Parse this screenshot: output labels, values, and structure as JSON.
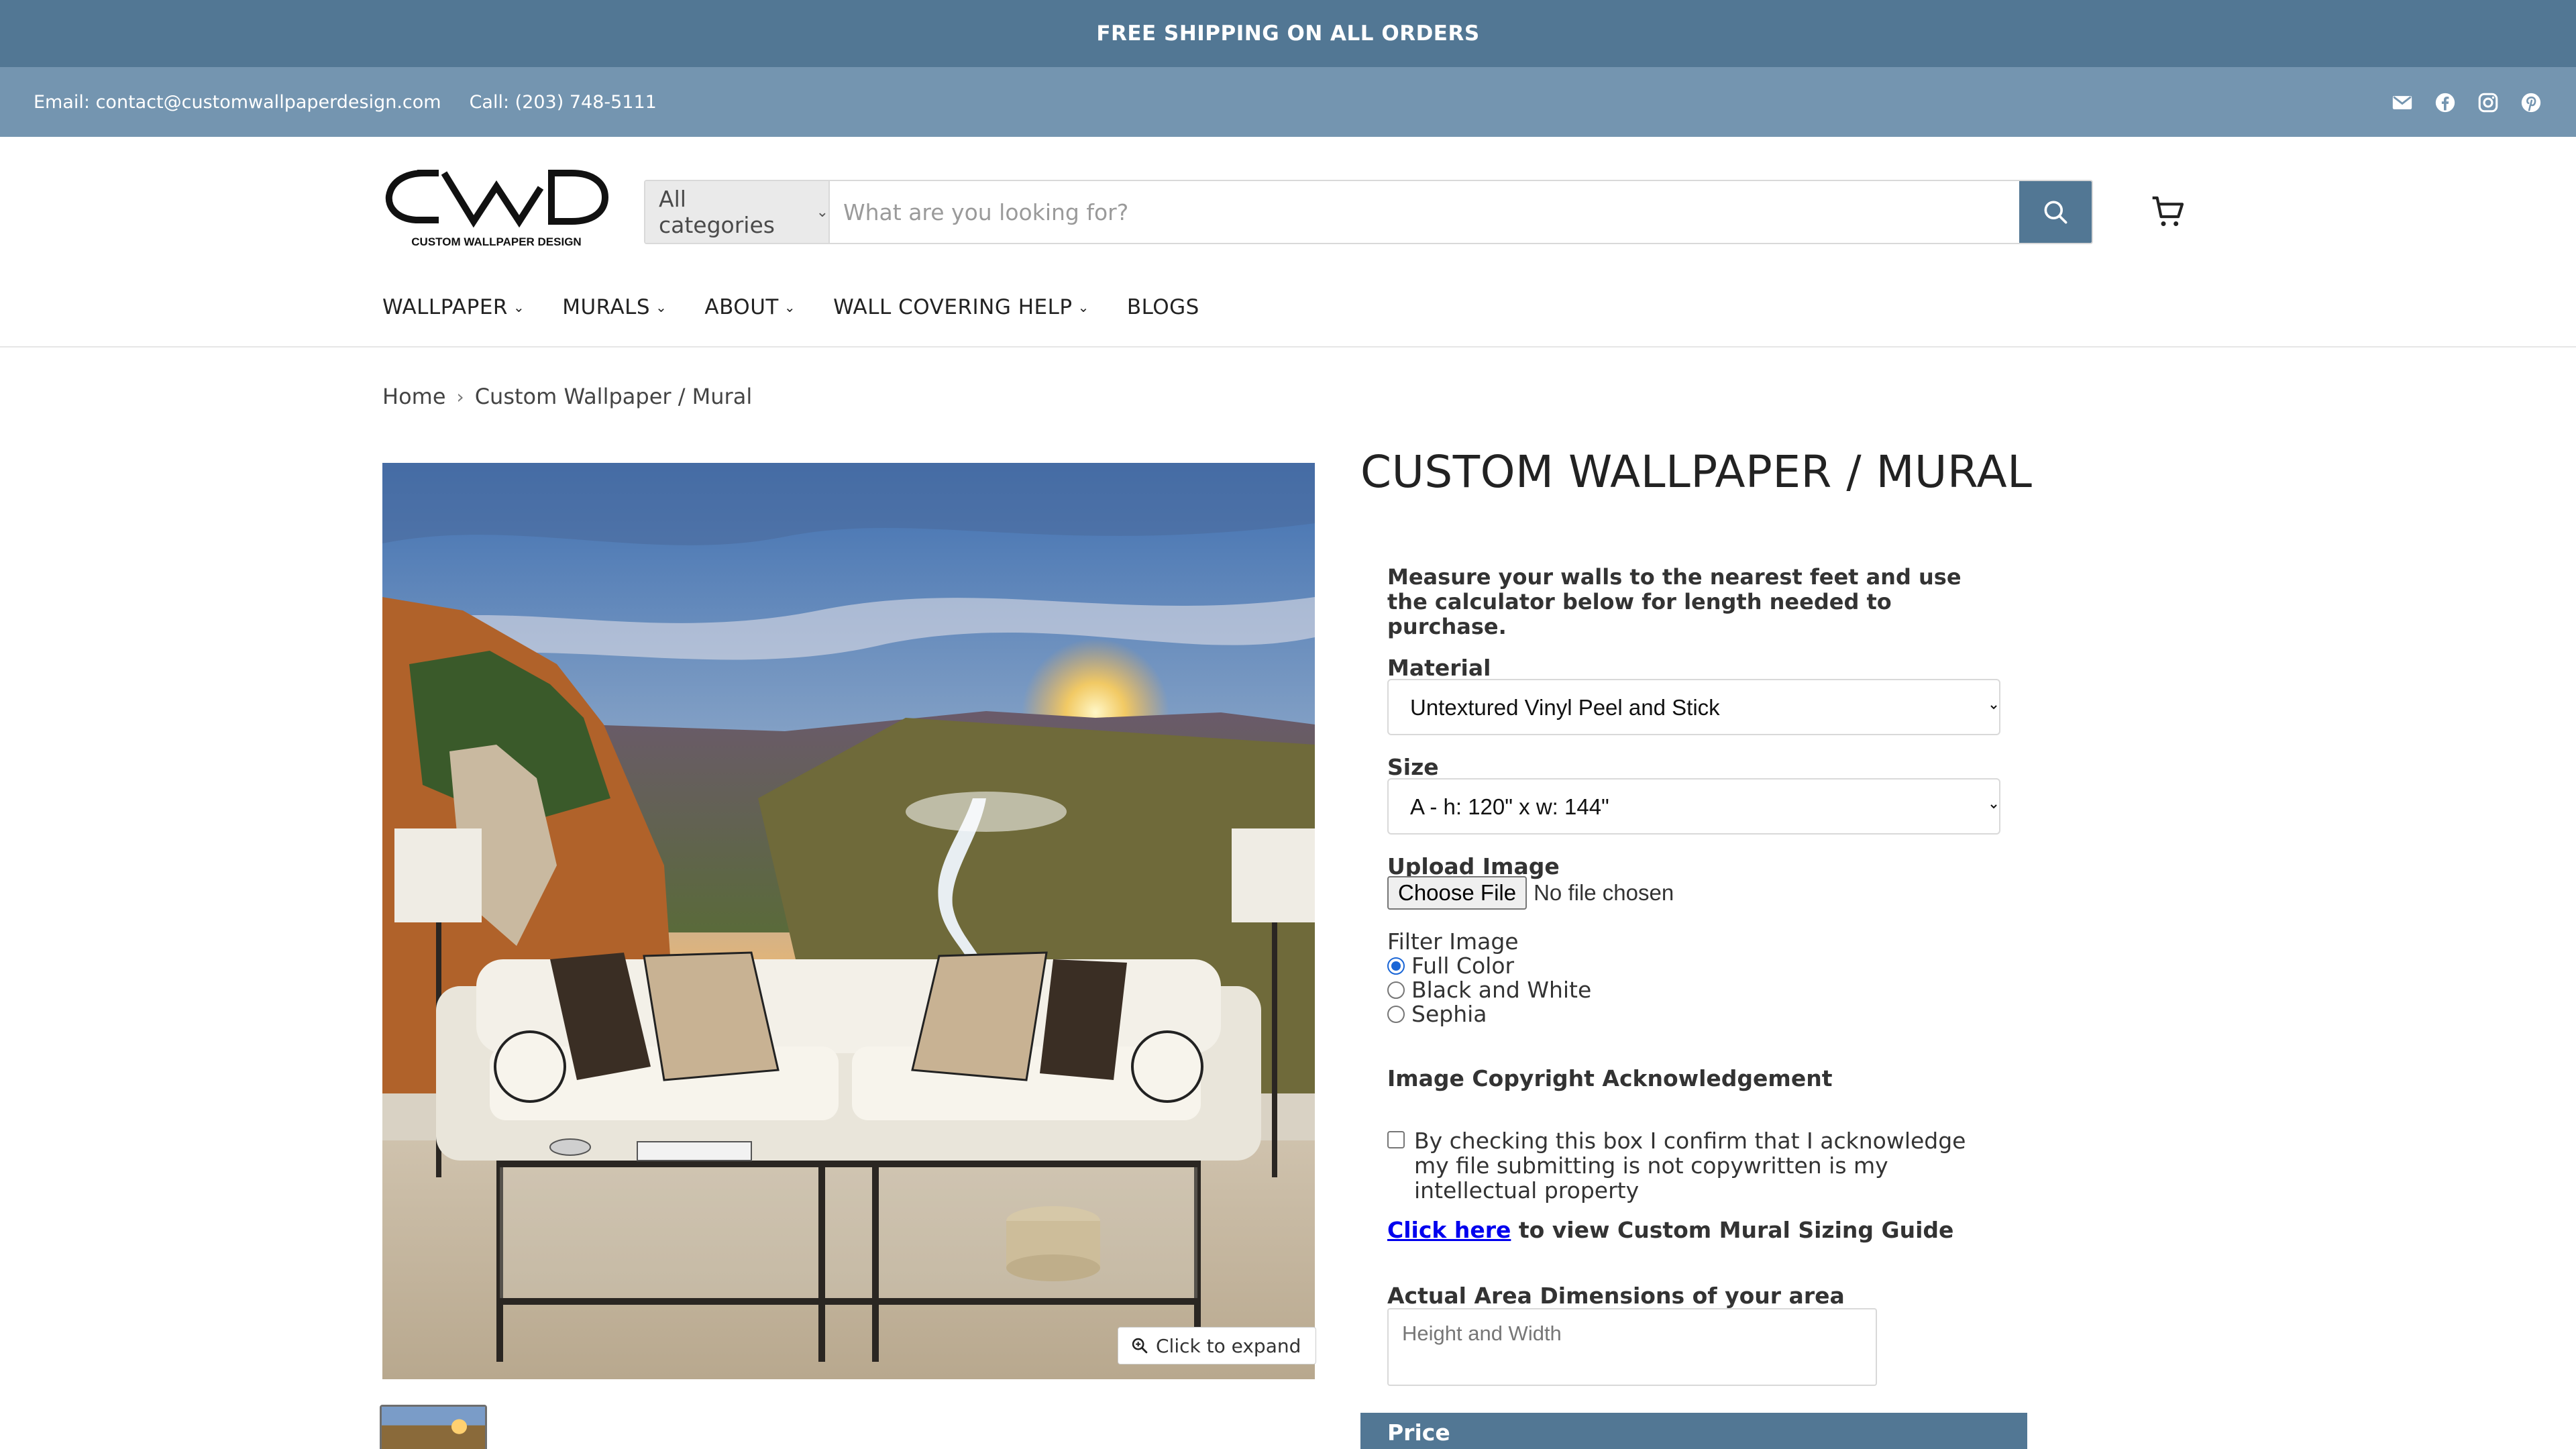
{
  "announcement": {
    "text": "FREE SHIPPING ON ALL ORDERS"
  },
  "utility": {
    "email": "Email: contact@customwallpaperdesign.com",
    "phone": "Call: (203) 748-5111",
    "social_icons": [
      "mail-icon",
      "facebook-icon",
      "instagram-icon",
      "pinterest-icon"
    ]
  },
  "header": {
    "logo_text": "CUSTOM WALLPAPER DESIGN",
    "search": {
      "category": "All categories",
      "placeholder": "What are you looking for?"
    }
  },
  "nav": [
    {
      "label": "WALLPAPER",
      "dropdown": true
    },
    {
      "label": "MURALS",
      "dropdown": true
    },
    {
      "label": "ABOUT",
      "dropdown": true
    },
    {
      "label": "WALL COVERING HELP",
      "dropdown": true
    },
    {
      "label": "BLOGS",
      "dropdown": false
    }
  ],
  "breadcrumb": {
    "home": "Home",
    "current": "Custom Wallpaper / Mural"
  },
  "product": {
    "title": "CUSTOM WALLPAPER / MURAL",
    "expand_label": "Click to expand"
  },
  "form": {
    "intro": "Measure your walls to the nearest feet and use the calculator below for length needed to purchase.",
    "material_label": "Material",
    "material_value": "Untextured Vinyl Peel and Stick",
    "size_label": "Size",
    "size_value": "A - h: 120\" x w: 144\"",
    "upload_label": "Upload Image",
    "file_button": "Choose File",
    "file_status": "No file chosen",
    "filter_label": "Filter Image",
    "filter_options": [
      "Full Color",
      "Black and White",
      "Sephia"
    ],
    "filter_selected": "Full Color",
    "copyright_label": "Image Copyright Acknowledgement",
    "copyright_text": "By checking this box I confirm that I acknowledge my file submitting is not copywritten is my intellectual property",
    "copyright_checked": false,
    "sizing_link": "Click here",
    "sizing_text": " to view Custom Mural Sizing Guide",
    "area_label": "Actual Area Dimensions of your area",
    "area_placeholder": "Height and Width",
    "price_label": "Price"
  },
  "colors": {
    "brand": "#527794",
    "utility_bar": "#7495b0",
    "link": "#0000ee"
  }
}
